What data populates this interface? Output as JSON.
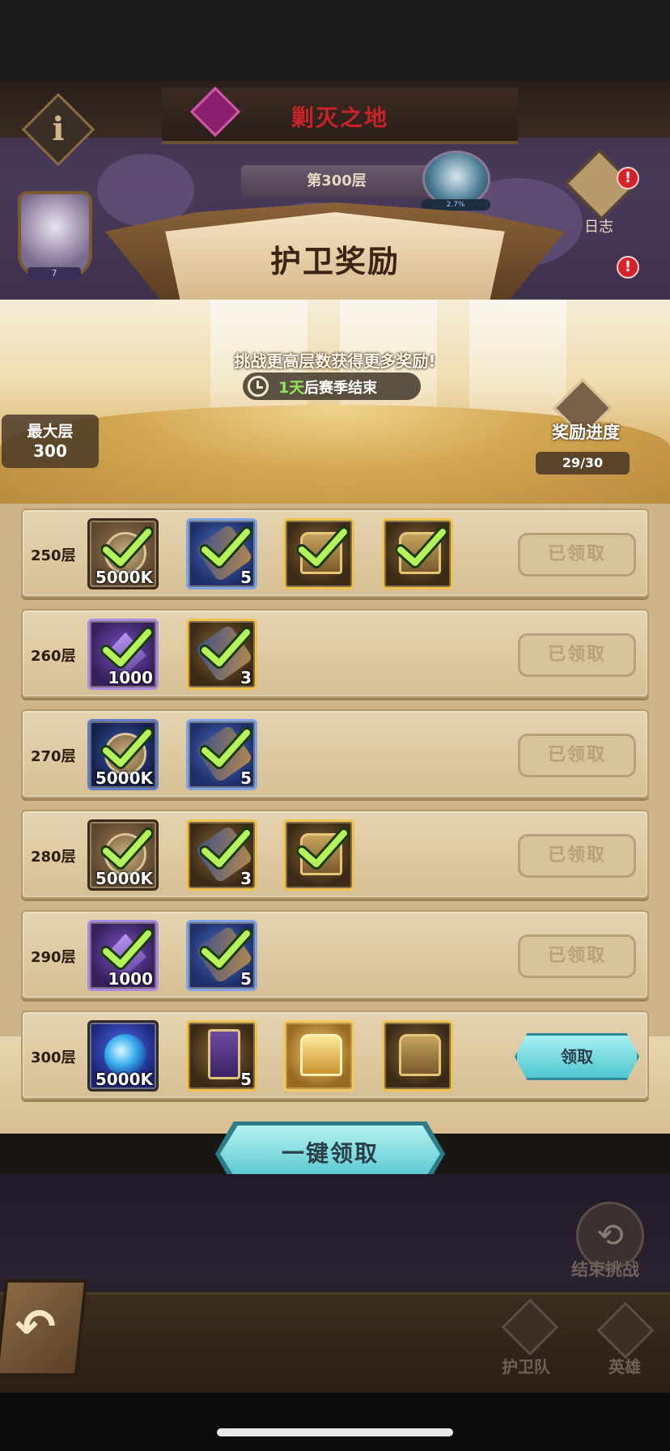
{
  "header": {
    "realm_title": "剿灭之地",
    "floor_label": "第300层",
    "boss_hp_text": "2.7%",
    "log_label": "日志",
    "log_badge": "!",
    "log_badge2": "!",
    "avatar_level": "7"
  },
  "panel": {
    "title": "护卫奖励",
    "challenge_text": "挑战更高层数获得更多奖励!",
    "season_days": "1天",
    "season_suffix": "后赛季结束",
    "max_floor_label": "最大层",
    "max_floor_value": "300",
    "progress_label": "奖励进度",
    "progress_value": "29/30"
  },
  "rows": [
    {
      "floor": "250层",
      "status": "已领取",
      "items": [
        {
          "icon": "coin-icon",
          "qty": "5000K",
          "claimed": true
        },
        {
          "icon": "scroll-icon",
          "qty": "5",
          "claimed": true
        },
        {
          "icon": "chest-icon",
          "qty": "",
          "claimed": true
        },
        {
          "icon": "treasure-chest-icon",
          "qty": "",
          "claimed": true
        }
      ]
    },
    {
      "floor": "260层",
      "status": "已领取",
      "items": [
        {
          "icon": "crystal-icon",
          "qty": "1000",
          "claimed": true
        },
        {
          "icon": "scroll-icon",
          "qty": "3",
          "claimed": true
        }
      ]
    },
    {
      "floor": "270层",
      "status": "已领取",
      "items": [
        {
          "icon": "coin-icon",
          "qty": "5000K",
          "claimed": true
        },
        {
          "icon": "scroll-icon",
          "qty": "5",
          "claimed": true
        }
      ]
    },
    {
      "floor": "280层",
      "status": "已领取",
      "items": [
        {
          "icon": "coin-icon",
          "qty": "5000K",
          "claimed": true
        },
        {
          "icon": "scroll-icon",
          "qty": "3",
          "claimed": true
        },
        {
          "icon": "chest-icon",
          "qty": "",
          "claimed": true
        }
      ]
    },
    {
      "floor": "290层",
      "status": "已领取",
      "items": [
        {
          "icon": "crystal-icon",
          "qty": "1000",
          "claimed": true
        },
        {
          "icon": "scroll-icon",
          "qty": "5",
          "claimed": true
        }
      ]
    },
    {
      "floor": "300层",
      "status": "领取",
      "items": [
        {
          "icon": "orb-icon",
          "qty": "5000K",
          "claimed": false
        },
        {
          "icon": "card-icon",
          "qty": "5",
          "claimed": false
        },
        {
          "icon": "gold-chest-icon",
          "qty": "",
          "claimed": false
        },
        {
          "icon": "treasure-chest-icon",
          "qty": "",
          "claimed": false
        }
      ]
    }
  ],
  "actions": {
    "claim_all": "一键领取",
    "end_challenge": "结束挑战"
  },
  "nav": {
    "guard": "护卫队",
    "hero": "英雄"
  },
  "colors": {
    "claim_accent": "#4fc6cf",
    "title_red": "#c8222a",
    "season_green": "#8fe65a"
  }
}
